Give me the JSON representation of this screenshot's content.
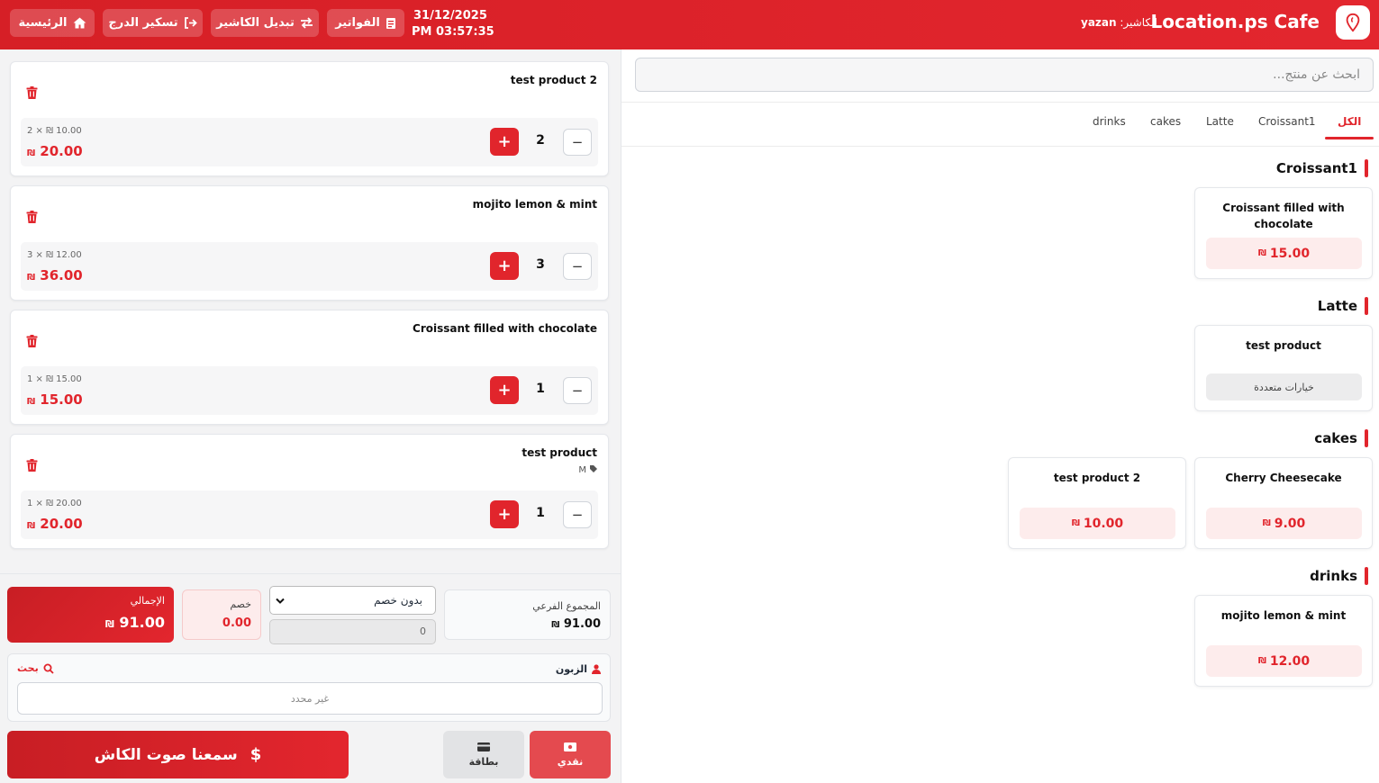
{
  "app": {
    "brand": "Location.ps Cafe",
    "cashier_label": "الكاشير:",
    "cashier_name": "yazan",
    "date": "31/12/2025",
    "time": "PM 03:57:35"
  },
  "header_buttons": {
    "home": "الرئيسية",
    "close_drawer": "تسكير الدرج",
    "switch_cashier": "تبديل الكاشير",
    "invoices": "الفواتير"
  },
  "currency": "₪",
  "cart": [
    {
      "name": "test product 2",
      "variant": "",
      "unit": "2 × ₪ 10.00",
      "total": "20.00",
      "qty": "2"
    },
    {
      "name": "mojito lemon & mint",
      "variant": "",
      "unit": "3 × ₪ 12.00",
      "total": "36.00",
      "qty": "3"
    },
    {
      "name": "Croissant filled with chocolate",
      "variant": "",
      "unit": "1 × ₪ 15.00",
      "total": "15.00",
      "qty": "1"
    },
    {
      "name": "test product",
      "variant": "M",
      "unit": "1 × ₪ 20.00",
      "total": "20.00",
      "qty": "1"
    }
  ],
  "summary": {
    "total_label": "الإجمالي",
    "total_value": "91.00",
    "discount_label": "خصم",
    "discount_value": "0.00",
    "discount_select": "بدون خصم",
    "discount_input": "0",
    "subtotal_label": "المجموع الفرعي",
    "subtotal_value": "91.00"
  },
  "customer": {
    "label": "الزبون",
    "search": "بحث",
    "value": "غير محدد"
  },
  "payment": {
    "main": "سمعنا صوت الكاش",
    "cash": "نقدي",
    "card": "بطاقة"
  },
  "search": {
    "placeholder": "ابحث عن منتج..."
  },
  "tabs": [
    "الكل",
    "Croissant1",
    "Latte",
    "cakes",
    "drinks"
  ],
  "sections": [
    {
      "title": "Croissant1",
      "products": [
        {
          "name": "Croissant filled with chocolate",
          "price": "15.00"
        }
      ]
    },
    {
      "title": "Latte",
      "products": [
        {
          "name": "test product",
          "options": "خيارات متعددة"
        }
      ]
    },
    {
      "title": "cakes",
      "products": [
        {
          "name": "Cherry Cheesecake",
          "price": "9.00"
        },
        {
          "name": "test product 2",
          "price": "10.00"
        }
      ]
    },
    {
      "title": "drinks",
      "products": [
        {
          "name": "mojito lemon & mint",
          "price": "12.00"
        }
      ]
    }
  ],
  "colors": {
    "accent": "#e1252c",
    "header": "#d61f26",
    "price_bg": "#fdecec"
  }
}
